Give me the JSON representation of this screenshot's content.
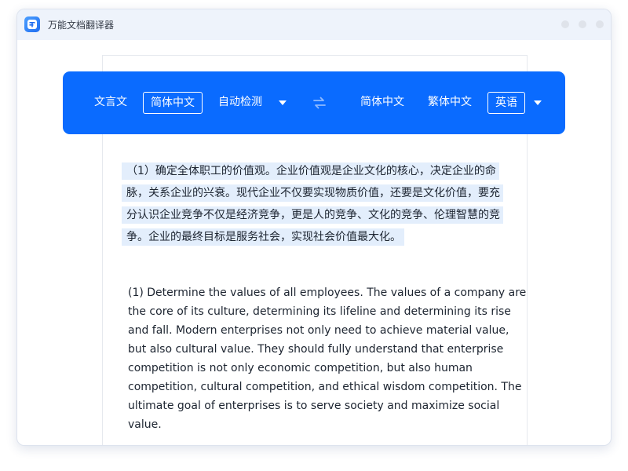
{
  "window": {
    "title": "万能文档翻译器"
  },
  "langbar": {
    "source_langs": [
      "文言文",
      "简体中文",
      "自动检测"
    ],
    "source_selected": "简体中文",
    "target_langs": [
      "简体中文",
      "繁体中文",
      "英语"
    ],
    "target_selected": "英语"
  },
  "source": {
    "lines": [
      "（1）确定全体职工的价值观。企业价值观是企业文化的核心，决定企业的命",
      "脉，关系企业的兴衰。现代企业不仅要实现物质价值，还要是文化价值，要充",
      "分认识企业竞争不仅是经济竞争，更是人的竞争、文化的竞争、伦理智慧的竞",
      "争。企业的最终目标是服务社会，实现社会价值最大化。"
    ]
  },
  "translation": {
    "lines": [
      "(1) Determine the values of all employees. The values of a company are",
      "the core of its culture, determining its lifeline and determining its rise",
      "and fall. Modern enterprises not only need to achieve material value,",
      "but also cultural value. They should fully understand that enterprise",
      "competition is not only economic competition, but also human",
      "competition, cultural competition, and ethical wisdom competition. The",
      "ultimate goal of enterprises is to serve society and maximize social",
      "value."
    ]
  },
  "colors": {
    "accent": "#0a6bff",
    "highlight": "#e3eefc",
    "titlebar": "#eef3fb"
  }
}
